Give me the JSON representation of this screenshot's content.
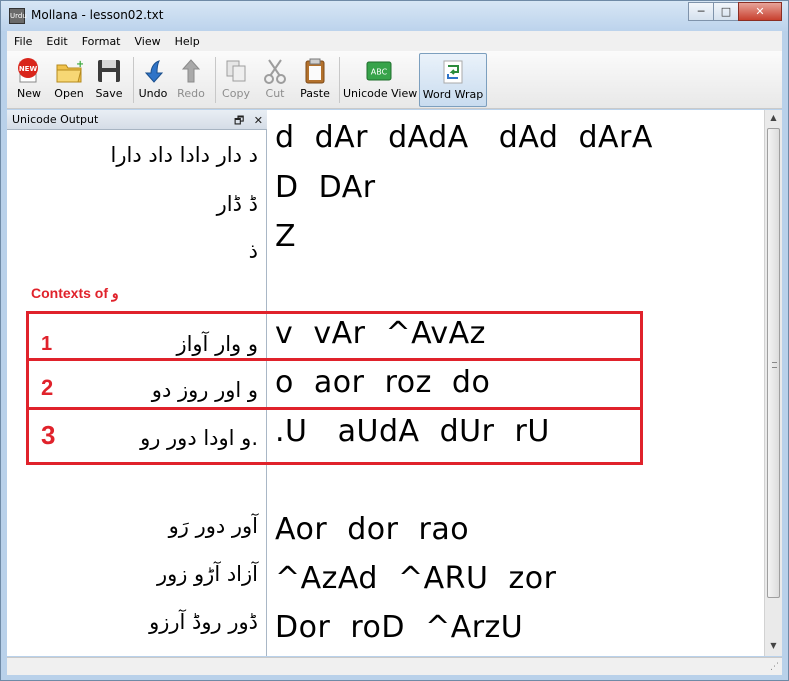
{
  "window": {
    "title": "Mollana - lesson02.txt",
    "app_icon_text": "Urdu",
    "minimize_glyph": "─",
    "maximize_glyph": "□",
    "close_glyph": "✕"
  },
  "menu": [
    "File",
    "Edit",
    "Format",
    "View",
    "Help"
  ],
  "toolbar": {
    "new": "New",
    "open": "Open",
    "save": "Save",
    "undo": "Undo",
    "redo": "Redo",
    "copy": "Copy",
    "cut": "Cut",
    "paste": "Paste",
    "unicode_view": "Unicode View",
    "word_wrap": "Word Wrap",
    "new_badge": "NEW",
    "abc_badge": "ABC"
  },
  "panel": {
    "title": "Unicode Output",
    "float_glyph": "🗗",
    "close_glyph": "✕"
  },
  "annotation": {
    "contexts_label": "Contexts of و",
    "numbers": [
      "1",
      "2",
      "3"
    ]
  },
  "lines": [
    {
      "urdu": "د دار دادا داد دارا",
      "roman": "d  dAr  dAdA   dAd  dArA"
    },
    {
      "urdu": "ڈ ڈار",
      "roman": "D  DAr"
    },
    {
      "urdu": "ذ",
      "roman": "Z"
    },
    {
      "urdu": "و وار آواز",
      "roman": "v  vAr  ^AvAz"
    },
    {
      "urdu": "و اور روز دو",
      "roman": "o  aor  roz  do"
    },
    {
      "urdu": ".و اودا دور رو",
      "roman": ".U   aUdA  dUr  rU"
    },
    {
      "urdu": "آور دور رَو",
      "roman": "Aor  dor  rao"
    },
    {
      "urdu": "آزاد آڑو زور",
      "roman": "^AzAd  ^ARU  zor"
    },
    {
      "urdu": "ڈور روڈ آرزو",
      "roman": "Dor  roD  ^ArzU"
    }
  ]
}
